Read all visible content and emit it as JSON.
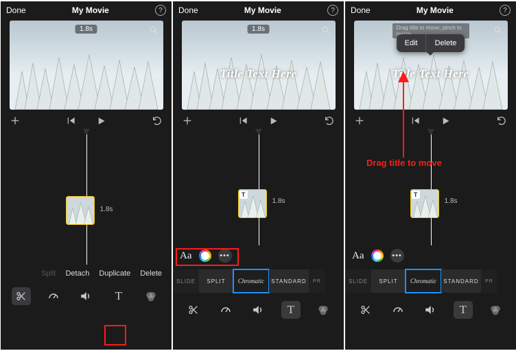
{
  "common": {
    "done": "Done",
    "title": "My Movie",
    "duration_pill": "1.8s",
    "clip_duration": "1.8s"
  },
  "panel1": {
    "edit": {
      "split": "Split",
      "detach": "Detach",
      "duplicate": "Duplicate",
      "delete": "Delete"
    }
  },
  "panel2": {
    "title_text": "Title Text Here",
    "aa": "Aa",
    "styles": {
      "slide": "SLIDE",
      "split": "SPLIT",
      "chromatic": "Chromatic",
      "standard": "STANDARD",
      "prism": "PR"
    }
  },
  "panel3": {
    "hint": "Drag title to move; pinch to resize",
    "popover": {
      "edit": "Edit",
      "delete": "Delete"
    },
    "title_text": "Title Text Here",
    "aa": "Aa",
    "styles": {
      "slide": "SLIDE",
      "split": "SPLIT",
      "chromatic": "Chromatic",
      "standard": "STANDARD",
      "prism": "PR"
    },
    "annotation": "Drag title to move"
  }
}
